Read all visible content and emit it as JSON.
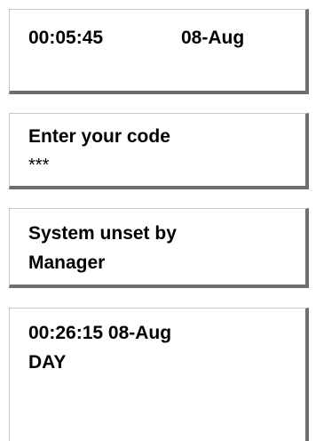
{
  "displays": [
    {
      "line1_time": "00:05:45",
      "line1_date": "08-Aug",
      "line2": ""
    },
    {
      "line1": "Enter your code",
      "line2": "***"
    },
    {
      "line1": "System unset by",
      "line2": "Manager"
    },
    {
      "line1": "00:26:15 08-Aug",
      "line2": "DAY"
    }
  ]
}
